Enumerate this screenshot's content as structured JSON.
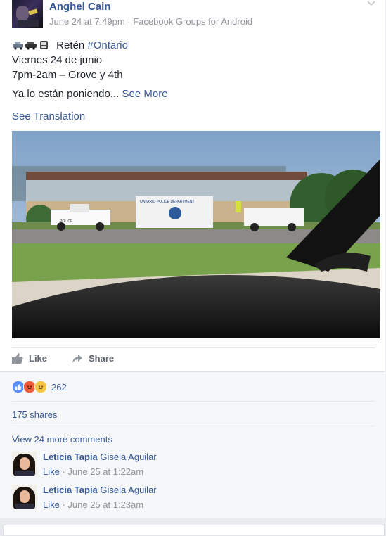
{
  "post": {
    "author": "Anghel Cain",
    "meta": "June 24 at 7:49pm · Facebook Groups for Android",
    "line1_word": "Retén",
    "line1_hashtag": "#Ontario",
    "line2": "Viernes 24 de junio",
    "line3": "7pm-2am – Grove y 4th",
    "line4": "Ya lo están poniendo...",
    "see_more": "See More",
    "see_translation": "See Translation",
    "photo_sign": "ONTARIO POLICE DEPARTMENT",
    "truck_text": "POLICE"
  },
  "actions": {
    "like": "Like",
    "share": "Share"
  },
  "reactions": {
    "count": "262",
    "types": [
      "like",
      "angry",
      "sad"
    ]
  },
  "shares": "175 shares",
  "view_more": "View 24 more comments",
  "comments": [
    {
      "name": "Leticia Tapia",
      "tag": "Gisela Aguilar",
      "like": "Like",
      "time": "· June 25 at 1:22am"
    },
    {
      "name": "Leticia Tapia",
      "tag": "Gisela Aguilar",
      "like": "Like",
      "time": "· June 25 at 1:23am"
    }
  ],
  "colors": {
    "link": "#365899",
    "meta": "#90949c",
    "like_reaction": "#5890ff",
    "angry_reaction": "#f05b3c",
    "sad_reaction": "#f7c544"
  }
}
